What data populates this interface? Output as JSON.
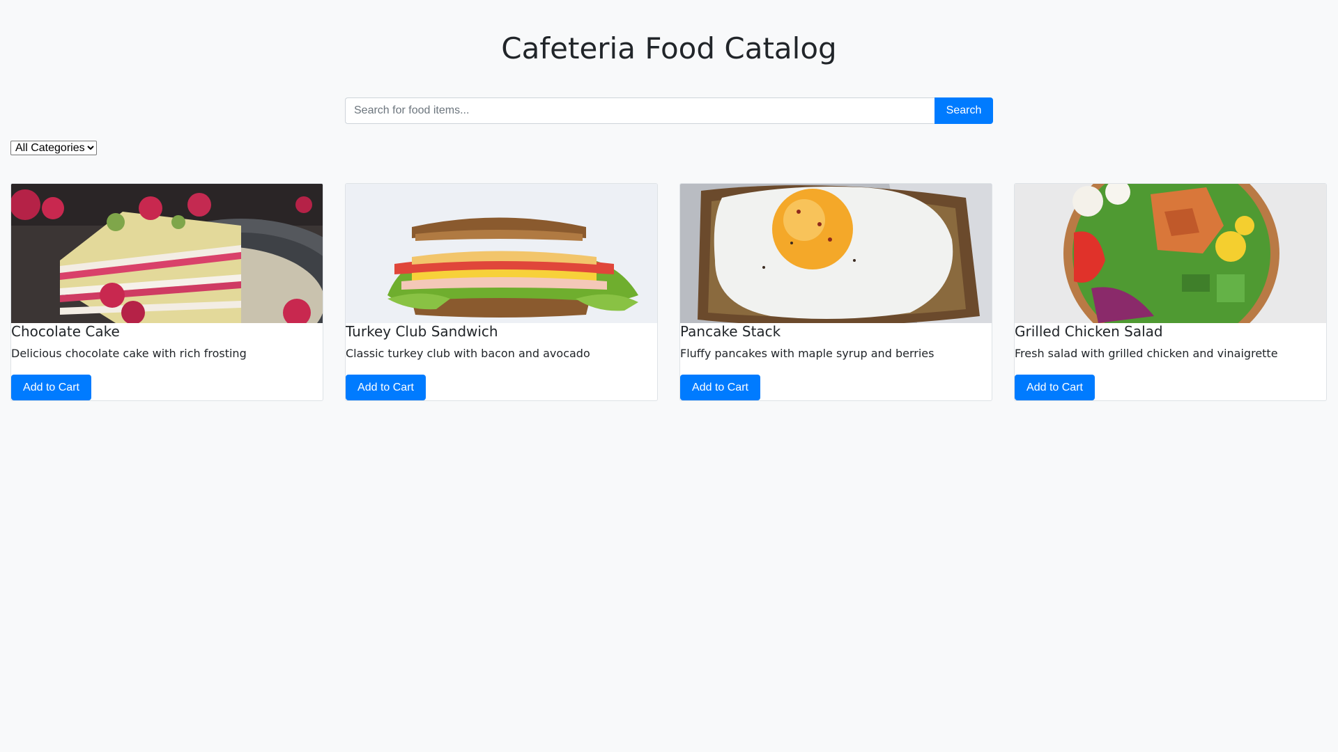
{
  "header": {
    "title": "Cafeteria Food Catalog"
  },
  "search": {
    "placeholder": "Search for food items...",
    "value": "",
    "button_label": "Search"
  },
  "filter": {
    "selected": "All Categories"
  },
  "products": [
    {
      "name": "Chocolate Cake",
      "description": "Delicious chocolate cake with rich frosting",
      "button_label": "Add to Cart",
      "image": "cake-slice-photo"
    },
    {
      "name": "Turkey Club Sandwich",
      "description": "Classic turkey club with bacon and avocado",
      "button_label": "Add to Cart",
      "image": "sandwich-photo"
    },
    {
      "name": "Pancake Stack",
      "description": "Fluffy pancakes with maple syrup and berries",
      "button_label": "Add to Cart",
      "image": "fried-egg-toast-photo"
    },
    {
      "name": "Grilled Chicken Salad",
      "description": "Fresh salad with grilled chicken and vinaigrette",
      "button_label": "Add to Cart",
      "image": "salad-bowl-photo"
    }
  ],
  "colors": {
    "background": "#f8f9fa",
    "primary": "#007bff",
    "text": "#212529",
    "border": "#dee2e6"
  }
}
